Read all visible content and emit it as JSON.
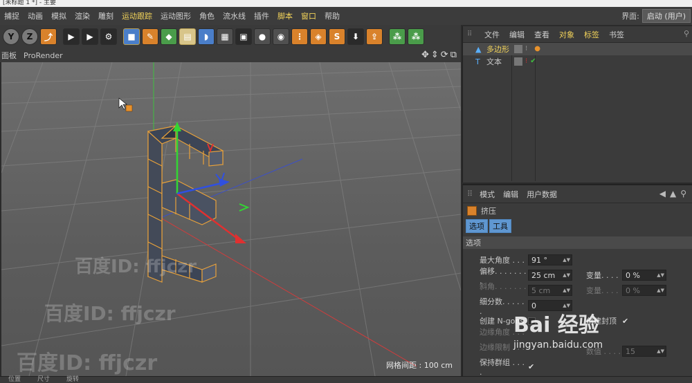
{
  "window": {
    "title": "[未标题 1 *] - 主要"
  },
  "menubar": {
    "items": [
      {
        "label": "捕捉",
        "hl": false
      },
      {
        "label": "动画",
        "hl": false
      },
      {
        "label": "模拟",
        "hl": false
      },
      {
        "label": "渲染",
        "hl": false
      },
      {
        "label": "雕刻",
        "hl": false
      },
      {
        "label": "运动跟踪",
        "hl": true
      },
      {
        "label": "运动图形",
        "hl": false
      },
      {
        "label": "角色",
        "hl": false
      },
      {
        "label": "流水线",
        "hl": false
      },
      {
        "label": "插件",
        "hl": false
      },
      {
        "label": "脚本",
        "hl": true
      },
      {
        "label": "窗口",
        "hl": true
      },
      {
        "label": "帮助",
        "hl": false
      }
    ],
    "layout_label": "界面:",
    "layout_value": "启动 (用户)"
  },
  "toolbar": {
    "tools": [
      {
        "name": "y-axis-lock-button",
        "glyph": "Y",
        "style": "round"
      },
      {
        "name": "z-axis-lock-button",
        "glyph": "Z",
        "style": "round"
      },
      {
        "name": "coordinate-system-button",
        "glyph": "⤴",
        "style": "orange"
      },
      {
        "name": "sep",
        "glyph": "",
        "style": "sep"
      },
      {
        "name": "render-view-button",
        "glyph": "▶",
        "style": "dark"
      },
      {
        "name": "render-picture-viewer-button",
        "glyph": "▶",
        "style": "dark"
      },
      {
        "name": "render-settings-button",
        "glyph": "⚙",
        "style": "dark"
      },
      {
        "name": "sep",
        "glyph": "",
        "style": "sep"
      },
      {
        "name": "cube-primitive-button",
        "glyph": "■",
        "style": "blue active"
      },
      {
        "name": "pen-spline-button",
        "glyph": "✎",
        "style": "orange"
      },
      {
        "name": "subdivision-surface-button",
        "glyph": "◆",
        "style": "green"
      },
      {
        "name": "array-generator-button",
        "glyph": "▤",
        "style": "active"
      },
      {
        "name": "deformer-button",
        "glyph": "◗",
        "style": "blue"
      },
      {
        "name": "floor-button",
        "glyph": "▦",
        "style": ""
      },
      {
        "name": "camera-button",
        "glyph": "▣",
        "style": "dark"
      },
      {
        "name": "light-button",
        "glyph": "●",
        "style": ""
      },
      {
        "name": "material-button",
        "glyph": "◉",
        "style": ""
      },
      {
        "name": "xpresso-button",
        "glyph": "⋮",
        "style": "orange"
      },
      {
        "name": "render-tag-button",
        "glyph": "◈",
        "style": "orange"
      },
      {
        "name": "script-button",
        "glyph": "S",
        "style": "orange"
      },
      {
        "name": "download-button",
        "glyph": "⬇",
        "style": "dark"
      },
      {
        "name": "upload-button",
        "glyph": "⇪",
        "style": "orange"
      },
      {
        "name": "sep",
        "glyph": "",
        "style": "sep"
      },
      {
        "name": "mograph-cloner-button",
        "glyph": "⁂",
        "style": "green"
      },
      {
        "name": "mograph-fracture-button",
        "glyph": "⁂",
        "style": "green"
      }
    ]
  },
  "viewport": {
    "tabs": [
      "面板",
      "ProRender"
    ],
    "grid_readout": "网格间距 : 100 cm"
  },
  "object_manager": {
    "menu": [
      {
        "label": "文件",
        "hl": false
      },
      {
        "label": "编辑",
        "hl": false
      },
      {
        "label": "查看",
        "hl": false
      },
      {
        "label": "对象",
        "hl": true
      },
      {
        "label": "标签",
        "hl": true
      },
      {
        "label": "书签",
        "hl": false
      }
    ],
    "objects": [
      {
        "name": "多边形",
        "selected": true,
        "icon": "polygon-icon"
      },
      {
        "name": "文本",
        "selected": false,
        "icon": "text-icon"
      }
    ]
  },
  "attribute_manager": {
    "menu": [
      "模式",
      "编辑",
      "用户数据"
    ],
    "object_name": "挤压",
    "tabs": [
      "选项",
      "工具"
    ],
    "section": "选项",
    "props": {
      "max_angle": {
        "label": "最大角度 . . .",
        "value": "91 °"
      },
      "offset": {
        "label": "偏移. . . . . . . .",
        "value": "25 cm"
      },
      "bevel": {
        "label": "斜角. . . . . . . .",
        "value": "5 cm"
      },
      "subdivision": {
        "label": "细分数. . . . . .",
        "value": "0"
      },
      "variance1": {
        "label": "变量. . . .",
        "value": "0 %"
      },
      "variance2": {
        "label": "变量. . . .",
        "value": "0 %"
      },
      "create_ngons": {
        "label": "创建 N-gons"
      },
      "create_caps": {
        "label": "创建封顶"
      },
      "edge_angle": {
        "label": "边缘角度 . . . ."
      },
      "edge_limit": {
        "label": "边缘限制 . . . ."
      },
      "keep_groups": {
        "label": "保持群组 . . . ."
      },
      "count_label": "数值 . . . .",
      "count_value": "15"
    }
  },
  "statusbar": {
    "items": [
      "位置",
      "尺寸",
      "旋转"
    ]
  },
  "watermarks": {
    "line": "百度ID: ffjczr",
    "brand_logo": "Bai 经验",
    "brand_url": "jingyan.baidu.com"
  },
  "colors": {
    "accent_yellow": "#f2d35a",
    "selection_orange": "#e8a13a",
    "axis_x": "#e03030",
    "axis_y": "#30c030",
    "axis_z": "#3050e0",
    "tab_blue": "#5f97d1"
  }
}
